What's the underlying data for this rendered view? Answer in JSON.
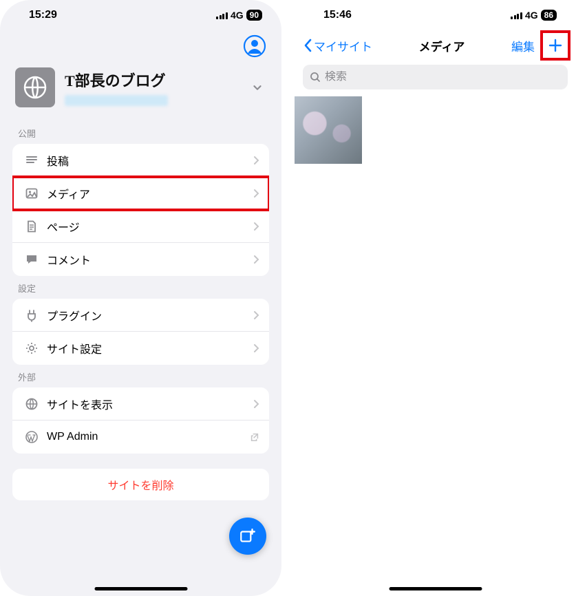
{
  "left": {
    "status": {
      "time": "15:29",
      "network": "4G",
      "battery": "90"
    },
    "site": {
      "title": "T部長のブログ"
    },
    "sections": {
      "publish": {
        "label": "公開",
        "items": [
          {
            "label": "投稿"
          },
          {
            "label": "メディア"
          },
          {
            "label": "ページ"
          },
          {
            "label": "コメント"
          }
        ]
      },
      "settings": {
        "label": "設定",
        "items": [
          {
            "label": "プラグイン"
          },
          {
            "label": "サイト設定"
          }
        ]
      },
      "external": {
        "label": "外部",
        "items": [
          {
            "label": "サイトを表示"
          },
          {
            "label": "WP Admin"
          }
        ]
      }
    },
    "delete_label": "サイトを削除"
  },
  "right": {
    "status": {
      "time": "15:46",
      "network": "4G",
      "battery": "86"
    },
    "nav": {
      "back": "マイサイト",
      "title": "メディア",
      "edit": "編集"
    },
    "search": {
      "placeholder": "検索"
    }
  }
}
